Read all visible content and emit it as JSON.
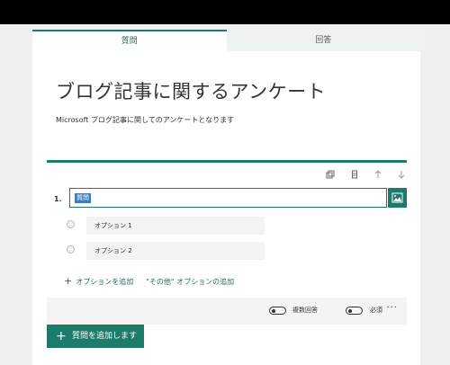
{
  "tabs": [
    {
      "label": "質問",
      "active": true
    },
    {
      "label": "回答",
      "active": false
    }
  ],
  "form": {
    "title": "ブログ記事に関するアンケート",
    "subtitle": "Microsoft ブログ記事に関してのアンケートとなります"
  },
  "question": {
    "number": "1.",
    "text_value": "質問",
    "toolbar_icons": [
      "copy-icon",
      "delete-icon",
      "move-up-icon",
      "move-down-icon"
    ],
    "image_icon": "insert-image-icon",
    "options": [
      "オプション 1",
      "オプション 2"
    ],
    "add_option_label": "オプションを追加",
    "add_other_label": "\"その他\" オプションの追加",
    "toggles": [
      {
        "label": "複数回答",
        "on": false
      },
      {
        "label": "必須",
        "on": false
      }
    ],
    "more_label": "···"
  },
  "add_question": {
    "plus": "+",
    "label": "質問を追加します"
  },
  "colors": {
    "accent": "#1d7b6c",
    "selection": "#2f7fd5",
    "topbar": "#000000",
    "page_bg": "#eef0f3"
  }
}
